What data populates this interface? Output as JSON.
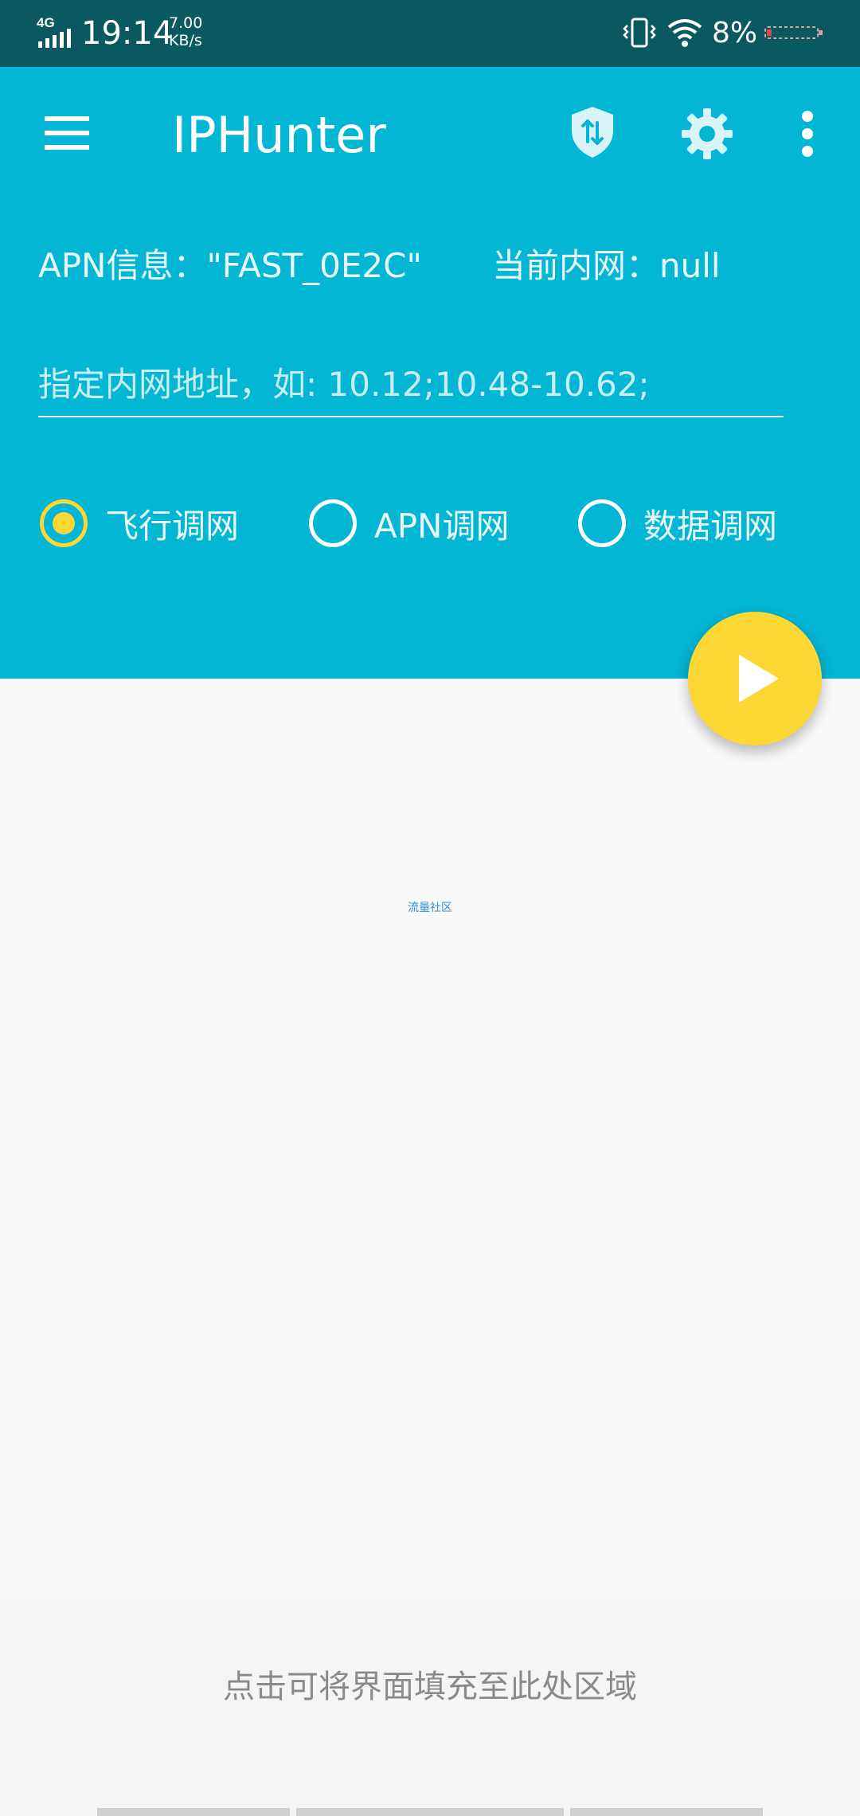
{
  "status_bar": {
    "network": "4G",
    "time": "19:14",
    "speed_value": "7.00",
    "speed_unit": "KB/s",
    "battery_percent": "8%",
    "icons": [
      "signal-icon",
      "vibrate-icon",
      "wifi-icon",
      "battery-icon"
    ]
  },
  "header": {
    "title": "IPHunter",
    "apn_info": "APN信息：\"FAST_0E2C\"",
    "intranet_info": "当前内网：null",
    "range_input": {
      "value": "",
      "placeholder": "指定内网地址，如: 10.12;10.48-10.62;"
    },
    "icons": [
      "menu-icon",
      "shield-icon",
      "gear-icon",
      "more-icon"
    ]
  },
  "modes": [
    {
      "label": "飞行调网",
      "selected": true
    },
    {
      "label": "APN调网",
      "selected": false
    },
    {
      "label": "数据调网",
      "selected": false
    }
  ],
  "community_link": "流量社区",
  "fill_hint": "点击可将界面填充至此处区域",
  "colors": {
    "status_bar": "#0a5961",
    "header": "#03b6d4",
    "accent": "#fdd835",
    "link": "#2a8fd8"
  }
}
